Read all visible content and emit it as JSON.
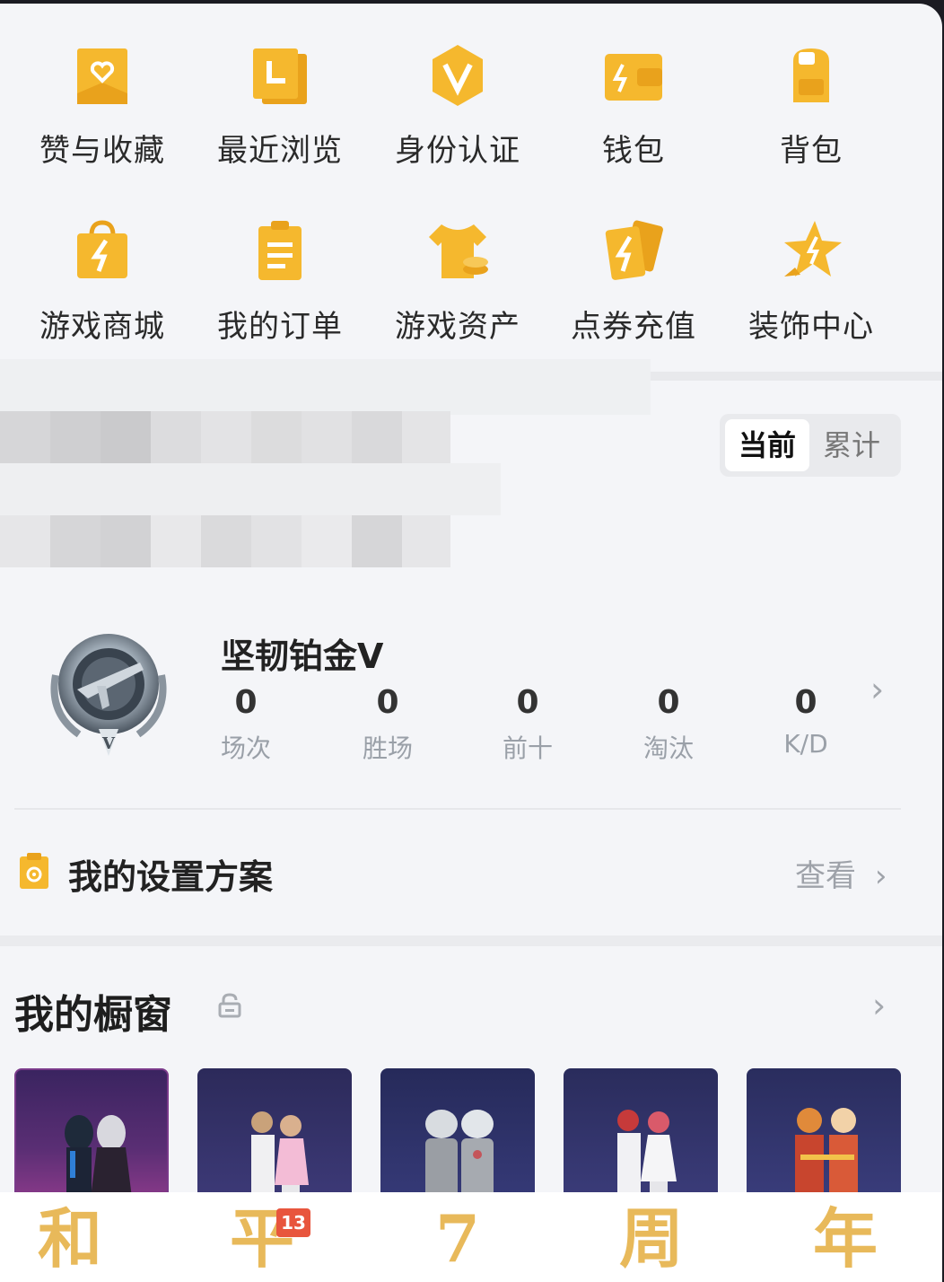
{
  "quick_menu": [
    {
      "label": "赞与收藏",
      "icon": "bookmark-heart-icon"
    },
    {
      "label": "最近浏览",
      "icon": "history-card-icon"
    },
    {
      "label": "身份认证",
      "icon": "v-verified-icon"
    },
    {
      "label": "钱包",
      "icon": "wallet-icon"
    },
    {
      "label": "背包",
      "icon": "backpack-icon"
    },
    {
      "label": "游戏商城",
      "icon": "shopping-bag-icon"
    },
    {
      "label": "我的订单",
      "icon": "clipboard-icon"
    },
    {
      "label": "游戏资产",
      "icon": "tshirt-coin-icon"
    },
    {
      "label": "点券充值",
      "icon": "lightning-cards-icon"
    },
    {
      "label": "装饰中心",
      "icon": "star-decoration-icon"
    }
  ],
  "season_toggle": {
    "current": "当前",
    "total": "累计",
    "selected": "current"
  },
  "rank": {
    "name": "坚韧铂金Ⅴ",
    "stats": [
      {
        "value": "0",
        "label": "场次"
      },
      {
        "value": "0",
        "label": "胜场"
      },
      {
        "value": "0",
        "label": "前十"
      },
      {
        "value": "0",
        "label": "淘汰"
      },
      {
        "value": "0",
        "label": "K/D"
      }
    ]
  },
  "settings": {
    "title": "我的设置方案",
    "link": "查看"
  },
  "showcase": {
    "title": "我的橱窗",
    "locked": true,
    "card_count": 5
  },
  "bottom_banner": {
    "chars": [
      "和",
      "平",
      "7",
      "周",
      "年"
    ],
    "badge": "13"
  },
  "colors": {
    "accent": "#f5b82e",
    "background": "#f4f5f8",
    "muted": "#9aa0a8"
  }
}
